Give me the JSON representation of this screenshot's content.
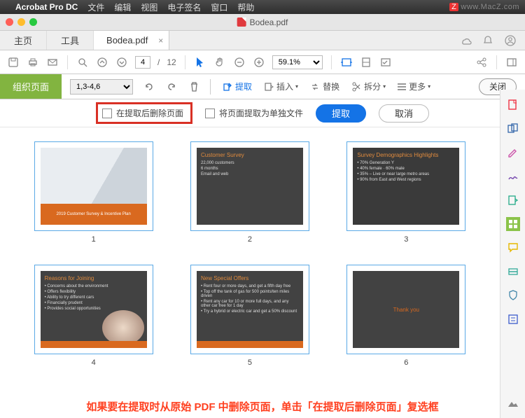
{
  "menubar": {
    "apple": "",
    "app": "Acrobat Pro DC",
    "items": [
      "文件",
      "编辑",
      "视图",
      "电子签名",
      "窗口",
      "帮助"
    ],
    "watermark_badge": "Z",
    "watermark": "www.MacZ.com"
  },
  "titlebar": {
    "document": "Bodea.pdf"
  },
  "tabs": {
    "home": "主页",
    "tools": "工具",
    "file": "Bodea.pdf",
    "close_x": "×"
  },
  "toolbar": {
    "page_current": "4",
    "page_sep": "/",
    "page_total": "12",
    "zoom": "59.1%"
  },
  "orgbar": {
    "title": "组织页面",
    "range": "1,3-4,6",
    "extract": "提取",
    "insert": "插入",
    "replace": "替换",
    "split": "拆分",
    "more": "更多",
    "close": "关闭"
  },
  "options": {
    "delete_after": "在提取后删除页面",
    "separate_files": "将页面提取为单独文件",
    "extract_btn": "提取",
    "cancel_btn": "取消"
  },
  "pages": {
    "p1": {
      "num": "1",
      "banner": "2019 Customer Survey & Incentive Plan"
    },
    "p2": {
      "num": "2",
      "title": "Customer Survey",
      "l1": "22,000 customers",
      "l2": "6 months",
      "l3": "Email and web"
    },
    "p3": {
      "num": "3",
      "title": "Survey Demographics Highlights",
      "l1": "• 70% Generation Y",
      "l2": "• 40% female · 60% male",
      "l3": "• 35% – Live or near large metro areas",
      "l4": "• 90% from East and West regions"
    },
    "p4": {
      "num": "4",
      "title": "Reasons for Joining",
      "l1": "• Concerns about the environment",
      "l2": "• Offers flexibility",
      "l3": "• Ability to try different cars",
      "l4": "• Financially prudent",
      "l5": "• Provides social opportunities"
    },
    "p5": {
      "num": "5",
      "title": "New Special Offers",
      "l1": "• Rent four or more days, and get a fifth day free",
      "l2": "• Top off the tank of gas for 500 points/ten miles driven",
      "l3": "• Rent any car for 10 or more full days, and any other car free for 1 day",
      "l4": "• Try a hybrid or electric car and get a 50% discount"
    },
    "p6": {
      "num": "6",
      "thank": "Thank you"
    }
  },
  "caption": "如果要在提取时从原始 PDF 中删除页面，单击「在提取后删除页面」复选框"
}
